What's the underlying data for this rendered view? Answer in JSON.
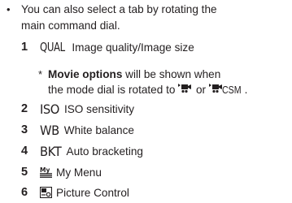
{
  "intro": {
    "bullet": "•",
    "line1": "You can also select a tab by rotating the",
    "line2": "main command dial."
  },
  "items": [
    {
      "number": "1",
      "code": "QUAL",
      "label": "Image quality/Image size"
    },
    {
      "number": "2",
      "code": "ISO",
      "label": "ISO sensitivity"
    },
    {
      "number": "3",
      "code": "WB",
      "label": "White balance"
    },
    {
      "number": "4",
      "code": "BKT",
      "label": "Auto bracketing"
    },
    {
      "number": "5",
      "icon": "my-menu-icon",
      "label": "My Menu"
    },
    {
      "number": "6",
      "icon": "picture-control-icon",
      "label": "Picture Control"
    }
  ],
  "note": {
    "star": "*",
    "bold_text": "Movie options",
    "text1": " will be shown when",
    "text2": "the mode dial is rotated to",
    "or_text": "or",
    "csm_text": "CSM",
    "end": "."
  }
}
